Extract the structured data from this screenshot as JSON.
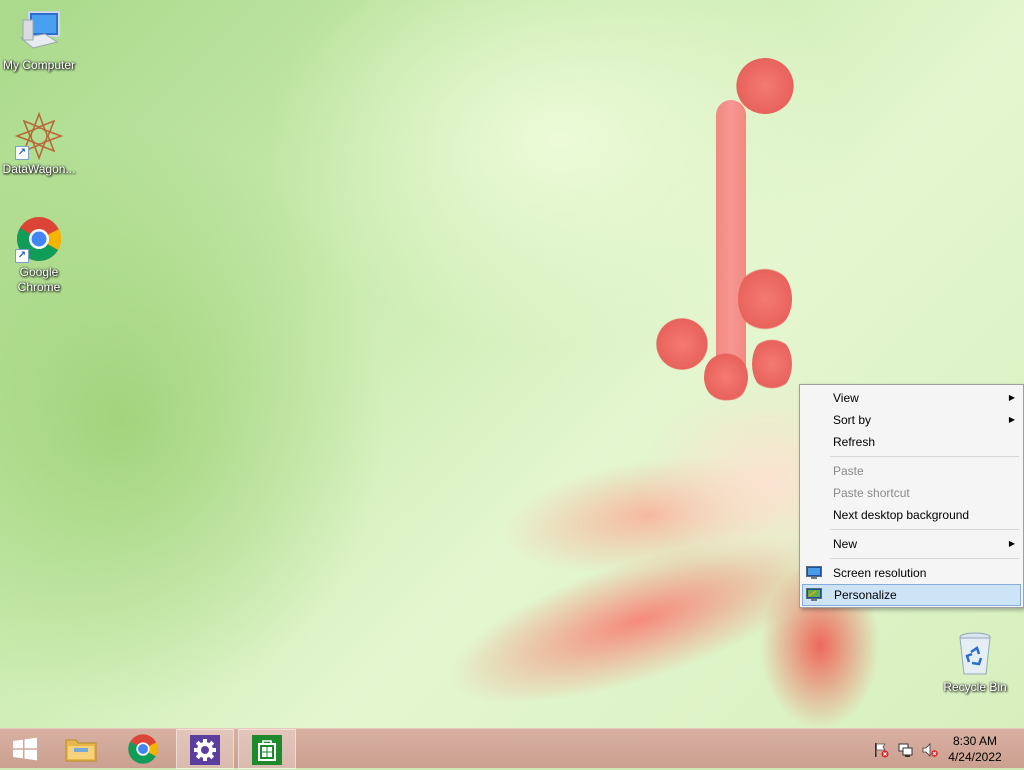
{
  "desktop": {
    "icons": [
      {
        "label": "My Computer"
      },
      {
        "label": "DataWagon..."
      },
      {
        "label": "Google\nChrome"
      },
      {
        "label": "Recycle Bin"
      }
    ]
  },
  "context_menu": {
    "items": [
      {
        "label": "View",
        "submenu": true
      },
      {
        "label": "Sort by",
        "submenu": true
      },
      {
        "label": "Refresh"
      },
      {
        "label": "Paste",
        "disabled": true
      },
      {
        "label": "Paste shortcut",
        "disabled": true
      },
      {
        "label": "Next desktop background"
      },
      {
        "label": "New",
        "submenu": true
      },
      {
        "label": "Screen resolution",
        "icon": "monitor-icon"
      },
      {
        "label": "Personalize",
        "icon": "monitor-icon",
        "highlighted": true
      }
    ],
    "submenu_arrow": "▶"
  },
  "taskbar": {
    "buttons": [
      {
        "icon": "windows-start-icon"
      },
      {
        "icon": "file-explorer-icon"
      },
      {
        "icon": "chrome-icon"
      },
      {
        "icon": "settings-gear-icon",
        "active": true
      },
      {
        "icon": "store-icon",
        "active": true
      }
    ],
    "tray": [
      "action-center-flag-icon",
      "network-icon",
      "volume-muted-icon"
    ],
    "clock": {
      "time": "8:30 AM",
      "date": "4/24/2022"
    }
  },
  "colors": {
    "taskbar": "#caa090",
    "menu_highlight": "#cde4f7",
    "settings_tile": "#5b3f9e",
    "store_tile": "#1e8a2e"
  }
}
